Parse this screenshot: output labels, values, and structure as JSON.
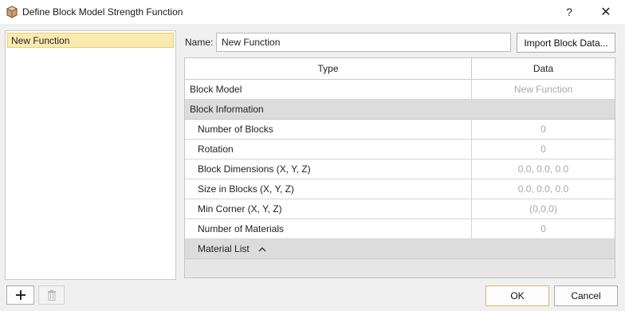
{
  "window": {
    "title": "Define Block Model Strength Function",
    "help_label": "?",
    "close_label": "✕"
  },
  "functions": [
    "New Function"
  ],
  "name": {
    "label": "Name:",
    "value": "New Function"
  },
  "import_button": "Import Block Data...",
  "grid": {
    "columns": [
      "Type",
      "Data"
    ],
    "block_model": {
      "label": "Block Model",
      "value": "New Function"
    },
    "block_information_label": "Block Information",
    "rows": [
      {
        "label": "Number of Blocks",
        "value": "0"
      },
      {
        "label": "Rotation",
        "value": "0"
      },
      {
        "label": "Block Dimensions (X, Y, Z)",
        "value": "0.0, 0.0, 0.0"
      },
      {
        "label": "Size in Blocks (X, Y, Z)",
        "value": "0.0, 0.0, 0.0"
      },
      {
        "label": "Min Corner (X, Y, Z)",
        "value": "(0,0,0)"
      },
      {
        "label": "Number of Materials",
        "value": "0"
      }
    ],
    "material_list_label": "Material List"
  },
  "buttons": {
    "add": "+",
    "ok": "OK",
    "cancel": "Cancel"
  },
  "colors": {
    "selection_fill": "#fbeab0",
    "group_row": "#dcdcdc",
    "disabled_text": "#a8a8a8"
  }
}
